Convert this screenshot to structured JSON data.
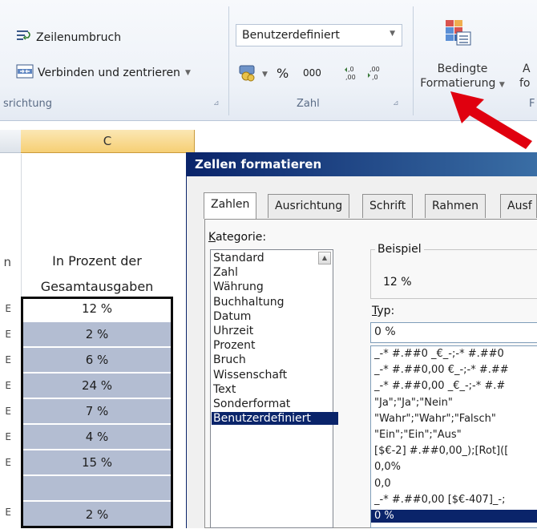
{
  "ribbon": {
    "alignment_group": {
      "wrap_text_label": "Zeilenumbruch",
      "merge_center_label": "Verbinden und zentrieren",
      "group_label": "srichtung"
    },
    "number_group": {
      "format_value": "Benutzerdefiniert",
      "percent_symbol": "%",
      "thousands_symbol": "000",
      "increase_decimal": ",0 ,00",
      "decrease_decimal": ",00 ,0",
      "group_label": "Zahl"
    },
    "styles_group": {
      "conditional_format_line1": "Bedingte",
      "conditional_format_line2": "Formatierung",
      "next_button_line1": "A",
      "next_button_line2": "fo",
      "group_label": "F"
    }
  },
  "sheet": {
    "column_c_header": "C",
    "left_row_marker": "n",
    "col_header_line1": "In Prozent der",
    "col_header_line2": "Gesamtausgaben",
    "row_marker": "E",
    "percent_values": [
      "12 %",
      "2 %",
      "6 %",
      "24 %",
      "7 %",
      "4 %",
      "15 %",
      "",
      "2 %"
    ]
  },
  "dialog": {
    "title": "Zellen formatieren",
    "tabs": [
      "Zahlen",
      "Ausrichtung",
      "Schrift",
      "Rahmen",
      "Ausf"
    ],
    "category_label": "Kategorie:",
    "category_label_accel": "K",
    "category_label_rest": "ategorie:",
    "categories": [
      "Standard",
      "Zahl",
      "Währung",
      "Buchhaltung",
      "Datum",
      "Uhrzeit",
      "Prozent",
      "Bruch",
      "Wissenschaft",
      "Text",
      "Sonderformat",
      "Benutzerdefiniert"
    ],
    "selected_category": "Benutzerdefiniert",
    "example_label": "Beispiel",
    "example_value": "12 %",
    "type_label_accel": "T",
    "type_label_rest": "yp:",
    "type_input_value": "0 %",
    "type_list": [
      "_-* #.##0 _€_-;-* #.##0",
      "_-* #.##0,00 €_-;-* #.##",
      "_-* #.##0,00 _€_-;-* #.#",
      "\"Ja\";\"Ja\";\"Nein\"",
      "\"Wahr\";\"Wahr\";\"Falsch\"",
      "\"Ein\";\"Ein\";\"Aus\"",
      "[$€-2] #.##0,00_);[Rot]([",
      "0,0%",
      "0,0",
      "_-* #.##0,00 [$€-407]_-;",
      "0 %"
    ],
    "selected_type": "0 %"
  },
  "colors": {
    "selection_fill": "#b3bdd2",
    "dialog_title": "#0a246a",
    "arrow": "#e0000f",
    "column_header_active": "#f6cf74"
  }
}
